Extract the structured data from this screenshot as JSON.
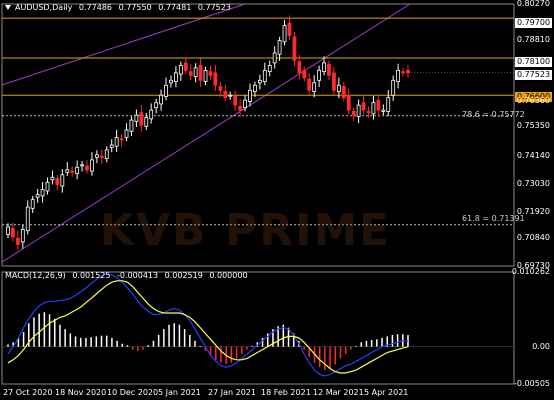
{
  "header": {
    "symbol": "AUDUSD,Daily",
    "open": "0.77486",
    "high": "0.77550",
    "low": "0.77481",
    "close": "0.77523"
  },
  "macd_header": {
    "name": "MACD(12,26,9)",
    "v1": "0.001525",
    "v2": "-0.000413",
    "v3": "0.002519",
    "v4": "0.000000"
  },
  "watermark": "KVB PRIME",
  "price_tags": {
    "r1": {
      "label": "0.79700",
      "bg": "#ffffff",
      "fg": "#000000"
    },
    "r2": {
      "label": "0.78100",
      "bg": "#ffffff",
      "fg": "#000000"
    },
    "current": {
      "label": "0.77523",
      "bg": "#ffffff",
      "fg": "#000000"
    },
    "s1": {
      "label": "0.76600",
      "bg": "#f0a000",
      "fg": "#000000"
    }
  },
  "fib_labels": {
    "f786": "78.6 = 0.75772",
    "f618": "61.8 = 0.71391"
  },
  "colors": {
    "up": "#ffffff",
    "down": "#ff2a2a",
    "level": "#e0a800",
    "channel": "#9a3fd0",
    "macd_main": "#2440ff",
    "macd_signal": "#ffff40"
  },
  "chart_data": [
    {
      "type": "candlestick",
      "title": "AUDUSD,Daily",
      "xlabel": "",
      "ylabel": "",
      "ylim": [
        0.6973,
        0.8027
      ],
      "yticks": [
        "0.80270",
        "0.79700",
        "0.78810",
        "0.78100",
        "0.77523",
        "0.76600",
        "0.76360",
        "0.75350",
        "0.74140",
        "0.73030",
        "0.71920",
        "0.70840",
        "0.69730"
      ],
      "xticks": [
        "27 Oct 2020",
        "18 Nov 2020",
        "10 Dec 2020",
        "5 Jan 2021",
        "27 Jan 2021",
        "18 Feb 2021",
        "12 Mar 2021",
        "5 Apr 2021"
      ],
      "close_path": [
        0.713,
        0.709,
        0.706,
        0.712,
        0.721,
        0.724,
        0.726,
        0.728,
        0.731,
        0.733,
        0.73,
        0.734,
        0.736,
        0.735,
        0.737,
        0.738,
        0.736,
        0.74,
        0.742,
        0.741,
        0.744,
        0.746,
        0.749,
        0.748,
        0.752,
        0.756,
        0.758,
        0.754,
        0.757,
        0.76,
        0.763,
        0.766,
        0.77,
        0.772,
        0.775,
        0.778,
        0.776,
        0.774,
        0.777,
        0.772,
        0.776,
        0.774,
        0.77,
        0.768,
        0.765,
        0.766,
        0.762,
        0.76,
        0.764,
        0.768,
        0.77,
        0.772,
        0.776,
        0.778,
        0.783,
        0.788,
        0.794,
        0.79,
        0.78,
        0.775,
        0.773,
        0.768,
        0.771,
        0.776,
        0.779,
        0.774,
        0.768,
        0.77,
        0.765,
        0.76,
        0.758,
        0.762,
        0.76,
        0.759,
        0.763,
        0.76,
        0.76,
        0.765,
        0.772,
        0.776,
        0.775,
        0.775
      ],
      "levels": [
        {
          "name": "0.79700",
          "value": 0.797
        },
        {
          "name": "0.78100",
          "value": 0.781
        },
        {
          "name": "0.76600",
          "value": 0.766
        }
      ],
      "fibonacci": [
        {
          "label": "78.6",
          "value": 0.75772
        },
        {
          "label": "61.8",
          "value": 0.71391
        }
      ],
      "grid": false
    },
    {
      "type": "histogram+line",
      "title": "MACD(12,26,9)",
      "ylim": [
        -0.0051,
        0.0102
      ],
      "yticks": [
        "0.010262",
        "0.00",
        "-0.00505"
      ],
      "histogram": [
        0.0003,
        0.0006,
        0.0012,
        0.002,
        0.0032,
        0.004,
        0.0045,
        0.0047,
        0.0044,
        0.0038,
        0.003,
        0.0024,
        0.0018,
        0.0014,
        0.0012,
        0.0012,
        0.0013,
        0.0014,
        0.0015,
        0.0015,
        0.0012,
        0.0008,
        0.0004,
        0.0002,
        -0.0004,
        -0.0006,
        -0.0004,
        0.0002,
        0.0008,
        0.0016,
        0.0024,
        0.003,
        0.0032,
        0.003,
        0.0024,
        0.0016,
        0.0008,
        0.0001,
        -0.0006,
        -0.0012,
        -0.0018,
        -0.0022,
        -0.0024,
        -0.0022,
        -0.0016,
        -0.001,
        -0.0004,
        0.0001,
        0.0006,
        0.0012,
        0.0018,
        0.0024,
        0.0028,
        0.003,
        0.0026,
        0.0018,
        0.0008,
        -0.0004,
        -0.0014,
        -0.0022,
        -0.0028,
        -0.0032,
        -0.003,
        -0.0024,
        -0.0016,
        -0.001,
        -0.0004,
        0.0001,
        0.0006,
        0.0008,
        0.0009,
        0.001,
        0.0012,
        0.0014,
        0.0016,
        0.0017,
        0.0017,
        0.0016
      ],
      "main": [
        -0.001,
        0.0,
        0.0012,
        0.0026,
        0.0038,
        0.0048,
        0.0056,
        0.006,
        0.0062,
        0.0062,
        0.0063,
        0.0064,
        0.0066,
        0.007,
        0.0075,
        0.008,
        0.0086,
        0.0092,
        0.0096,
        0.01,
        0.0098,
        0.0094,
        0.0088,
        0.008,
        0.0072,
        0.0062,
        0.0054,
        0.0048,
        0.0044,
        0.0044,
        0.0046,
        0.005,
        0.0052,
        0.005,
        0.0044,
        0.0036,
        0.0024,
        0.0012,
        0.0,
        -0.0012,
        -0.002,
        -0.0026,
        -0.0028,
        -0.0026,
        -0.0022,
        -0.0016,
        -0.001,
        -0.0004,
        0.0002,
        0.0008,
        0.0014,
        0.002,
        0.0024,
        0.0026,
        0.0024,
        0.0016,
        0.0004,
        -0.001,
        -0.0022,
        -0.0032,
        -0.0038,
        -0.004,
        -0.0038,
        -0.0034,
        -0.003,
        -0.0026,
        -0.0024,
        -0.002,
        -0.0016,
        -0.0012,
        -0.0008,
        -0.0004,
        0.0,
        0.0002,
        0.0004,
        0.0006,
        0.0008,
        0.0008
      ],
      "signal": [
        -0.0022,
        -0.0018,
        -0.0012,
        -0.0004,
        0.0006,
        0.0014,
        0.002,
        0.0026,
        0.0032,
        0.0036,
        0.004,
        0.0042,
        0.0046,
        0.005,
        0.0054,
        0.006,
        0.0066,
        0.0072,
        0.0078,
        0.0084,
        0.0088,
        0.009,
        0.009,
        0.0088,
        0.0082,
        0.0074,
        0.0066,
        0.0058,
        0.0052,
        0.0048,
        0.0046,
        0.0046,
        0.0046,
        0.0046,
        0.0044,
        0.004,
        0.0034,
        0.0026,
        0.0018,
        0.001,
        0.0002,
        -0.0006,
        -0.0012,
        -0.0016,
        -0.0018,
        -0.0018,
        -0.0016,
        -0.0012,
        -0.0008,
        -0.0004,
        0.0,
        0.0004,
        0.0008,
        0.0012,
        0.0014,
        0.0014,
        0.0012,
        0.0006,
        -0.0002,
        -0.001,
        -0.0018,
        -0.0024,
        -0.003,
        -0.0034,
        -0.0036,
        -0.0036,
        -0.0034,
        -0.0032,
        -0.0028,
        -0.0024,
        -0.002,
        -0.0016,
        -0.0012,
        -0.0008,
        -0.0006,
        -0.0004,
        -0.0002,
        0.0
      ]
    }
  ]
}
